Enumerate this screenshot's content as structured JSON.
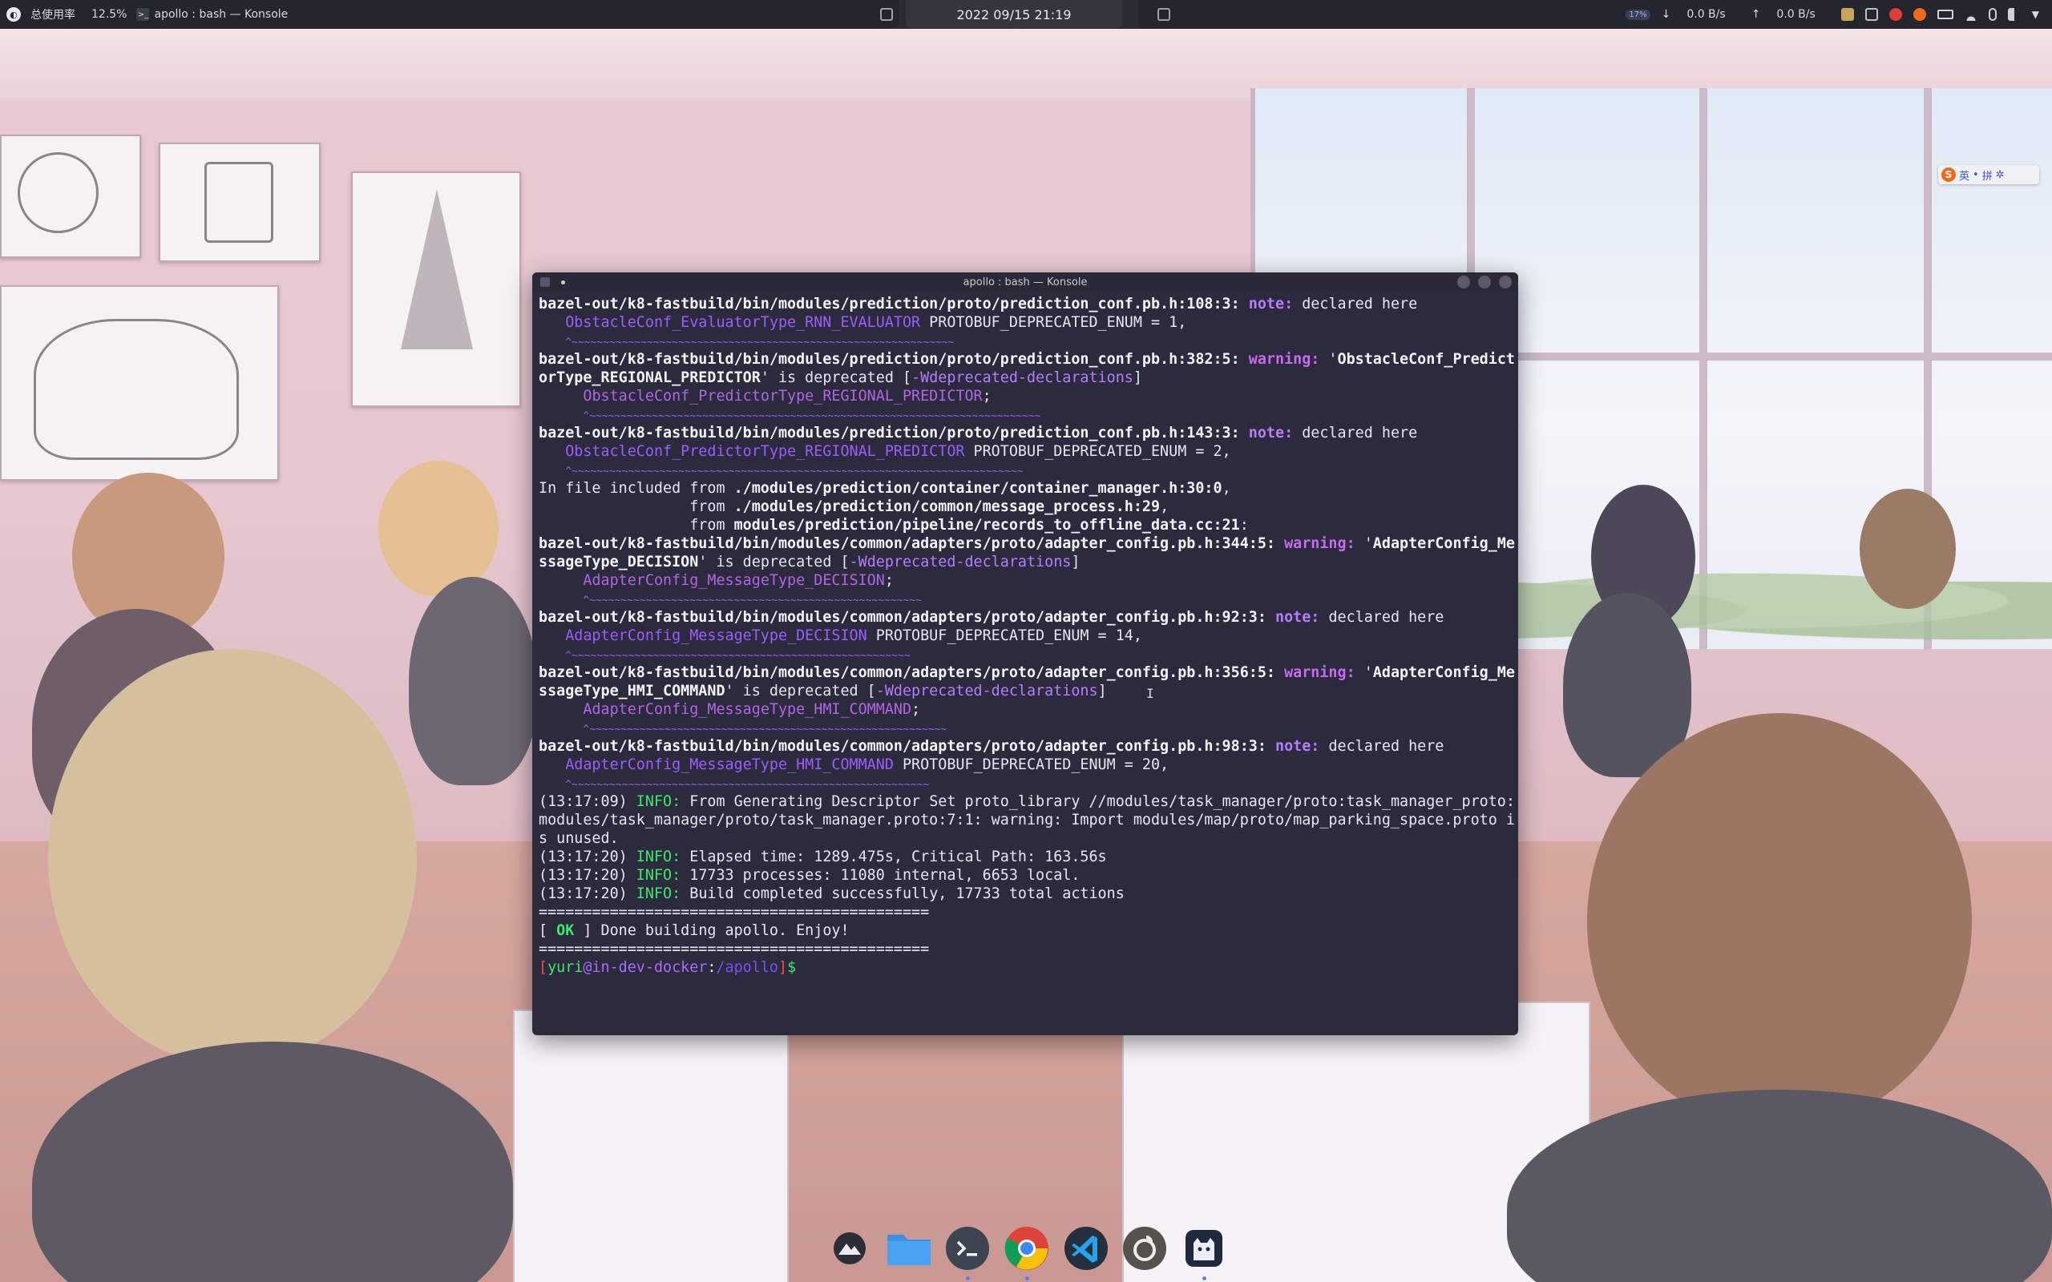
{
  "top_panel": {
    "cpu_label": "总使用率",
    "cpu_value": "12.5%",
    "active_window": "apollo : bash — Konsole",
    "datetime": "2022 09/15 21:19",
    "down_rate": "0.0 B/s",
    "up_rate": "0.0 B/s",
    "down_arrow": "↓",
    "up_arrow": "↑",
    "battery_badge": "17%"
  },
  "ime": {
    "mode": "英",
    "dot": "•",
    "pinyin": "拼",
    "settings": "✲"
  },
  "window": {
    "title": "apollo : bash — Konsole"
  },
  "terminal": {
    "lines": [
      [
        [
          "b",
          "bazel-out/k8-fastbuild/bin/modules/prediction/proto/prediction_conf.pb.h:108:3:"
        ],
        [
          "t",
          " "
        ],
        [
          "note",
          "note:"
        ],
        [
          "t",
          " declared here"
        ]
      ],
      [
        [
          "t",
          "   "
        ],
        [
          "sym",
          "ObstacleConf_EvaluatorType_RNN_EVALUATOR"
        ],
        [
          "t",
          " PROTOBUF_DEPRECATED_ENUM = 1,"
        ]
      ],
      [
        [
          "t",
          "   "
        ],
        [
          "tilde",
          "^~~~~~~~~~~~~~~~~~~~~~~~~~~~~~~~~~~~~~~~~~~~~~~~~~~~~~~~~~~~~~"
        ]
      ],
      [
        [
          "b",
          "bazel-out/k8-fastbuild/bin/modules/prediction/proto/prediction_conf.pb.h:382:5:"
        ],
        [
          "t",
          " "
        ],
        [
          "warn",
          "warning:"
        ],
        [
          "t",
          " '"
        ],
        [
          "b",
          "ObstacleConf_Predict"
        ]
      ],
      [
        [
          "b",
          "orType_REGIONAL_PREDICTOR"
        ],
        [
          "t",
          "' is deprecated ["
        ],
        [
          "flag",
          "-Wdeprecated-declarations"
        ],
        [
          "t",
          "]"
        ]
      ],
      [
        [
          "t",
          "     "
        ],
        [
          "sym2",
          "ObstacleConf_PredictorType_REGIONAL_PREDICTOR"
        ],
        [
          "t",
          ";"
        ]
      ],
      [
        [
          "t",
          "     "
        ],
        [
          "tilde",
          "^~~~~~~~~~~~~~~~~~~~~~~~~~~~~~~~~~~~~~~~~~~~~~~~~~~~~~~~~~~~~~~~~~~~~~~~~"
        ]
      ],
      [
        [
          "b",
          "bazel-out/k8-fastbuild/bin/modules/prediction/proto/prediction_conf.pb.h:143:3:"
        ],
        [
          "t",
          " "
        ],
        [
          "note",
          "note:"
        ],
        [
          "t",
          " declared here"
        ]
      ],
      [
        [
          "t",
          "   "
        ],
        [
          "sym",
          "ObstacleConf_PredictorType_REGIONAL_PREDICTOR"
        ],
        [
          "t",
          " PROTOBUF_DEPRECATED_ENUM = 2,"
        ]
      ],
      [
        [
          "t",
          "   "
        ],
        [
          "tilde",
          "^~~~~~~~~~~~~~~~~~~~~~~~~~~~~~~~~~~~~~~~~~~~~~~~~~~~~~~~~~~~~~~~~~~~~~~~~"
        ]
      ],
      [
        [
          "t",
          "In file included from "
        ],
        [
          "b",
          "./modules/prediction/container/container_manager.h:30:0"
        ],
        [
          "t",
          ","
        ]
      ],
      [
        [
          "t",
          "                 from "
        ],
        [
          "b",
          "./modules/prediction/common/message_process.h:29"
        ],
        [
          "t",
          ","
        ]
      ],
      [
        [
          "t",
          "                 from "
        ],
        [
          "b",
          "modules/prediction/pipeline/records_to_offline_data.cc:21"
        ],
        [
          "t",
          ":"
        ]
      ],
      [
        [
          "b",
          "bazel-out/k8-fastbuild/bin/modules/common/adapters/proto/adapter_config.pb.h:344:5:"
        ],
        [
          "t",
          " "
        ],
        [
          "warn",
          "warning:"
        ],
        [
          "t",
          " '"
        ],
        [
          "b",
          "AdapterConfig_Me"
        ]
      ],
      [
        [
          "b",
          "ssageType_DECISION"
        ],
        [
          "t",
          "' is deprecated ["
        ],
        [
          "flag",
          "-Wdeprecated-declarations"
        ],
        [
          "t",
          "]"
        ]
      ],
      [
        [
          "t",
          "     "
        ],
        [
          "sym2",
          "AdapterConfig_MessageType_DECISION"
        ],
        [
          "t",
          ";"
        ]
      ],
      [
        [
          "t",
          "     "
        ],
        [
          "tilde",
          "^~~~~~~~~~~~~~~~~~~~~~~~~~~~~~~~~~~~~~~~~~~~~~~~~~~~~~"
        ]
      ],
      [
        [
          "b",
          "bazel-out/k8-fastbuild/bin/modules/common/adapters/proto/adapter_config.pb.h:92:3:"
        ],
        [
          "t",
          " "
        ],
        [
          "note",
          "note:"
        ],
        [
          "t",
          " declared here"
        ]
      ],
      [
        [
          "t",
          "   "
        ],
        [
          "sym",
          "AdapterConfig_MessageType_DECISION"
        ],
        [
          "t",
          " PROTOBUF_DEPRECATED_ENUM = 14,"
        ]
      ],
      [
        [
          "t",
          "   "
        ],
        [
          "tilde",
          "^~~~~~~~~~~~~~~~~~~~~~~~~~~~~~~~~~~~~~~~~~~~~~~~~~~~~~~"
        ]
      ],
      [
        [
          "b",
          "bazel-out/k8-fastbuild/bin/modules/common/adapters/proto/adapter_config.pb.h:356:5:"
        ],
        [
          "t",
          " "
        ],
        [
          "warn",
          "warning:"
        ],
        [
          "t",
          " '"
        ],
        [
          "b",
          "AdapterConfig_Me"
        ]
      ],
      [
        [
          "b",
          "ssageType_HMI_COMMAND"
        ],
        [
          "t",
          "' is deprecated ["
        ],
        [
          "flag",
          "-Wdeprecated-declarations"
        ],
        [
          "t",
          "]"
        ]
      ],
      [
        [
          "t",
          "     "
        ],
        [
          "sym2",
          "AdapterConfig_MessageType_HMI_COMMAND"
        ],
        [
          "t",
          ";"
        ]
      ],
      [
        [
          "t",
          "     "
        ],
        [
          "tilde",
          "^~~~~~~~~~~~~~~~~~~~~~~~~~~~~~~~~~~~~~~~~~~~~~~~~~~~~~~~~~"
        ]
      ],
      [
        [
          "b",
          "bazel-out/k8-fastbuild/bin/modules/common/adapters/proto/adapter_config.pb.h:98:3:"
        ],
        [
          "t",
          " "
        ],
        [
          "note",
          "note:"
        ],
        [
          "t",
          " declared here"
        ]
      ],
      [
        [
          "t",
          "   "
        ],
        [
          "sym",
          "AdapterConfig_MessageType_HMI_COMMAND"
        ],
        [
          "t",
          " PROTOBUF_DEPRECATED_ENUM = 20,"
        ]
      ],
      [
        [
          "t",
          "   "
        ],
        [
          "tilde",
          "^~~~~~~~~~~~~~~~~~~~~~~~~~~~~~~~~~~~~~~~~~~~~~~~~~~~~~~~~~"
        ]
      ],
      [
        [
          "t",
          "(13:17:09) "
        ],
        [
          "grn",
          "INFO:"
        ],
        [
          "t",
          " From Generating Descriptor Set proto_library //modules/task_manager/proto:task_manager_proto:"
        ]
      ],
      [
        [
          "t",
          "modules/task_manager/proto/task_manager.proto:7:1: warning: Import modules/map/proto/map_parking_space.proto i"
        ]
      ],
      [
        [
          "t",
          "s unused."
        ]
      ],
      [
        [
          "t",
          "(13:17:20) "
        ],
        [
          "grn",
          "INFO:"
        ],
        [
          "t",
          " Elapsed time: 1289.475s, Critical Path: 163.56s"
        ]
      ],
      [
        [
          "t",
          "(13:17:20) "
        ],
        [
          "grn",
          "INFO:"
        ],
        [
          "t",
          " 17733 processes: 11080 internal, 6653 local."
        ]
      ],
      [
        [
          "t",
          "(13:17:20) "
        ],
        [
          "grn",
          "INFO:"
        ],
        [
          "t",
          " Build completed successfully, 17733 total actions"
        ]
      ],
      [
        [
          "t",
          "============================================"
        ]
      ],
      [
        [
          "t",
          "[ "
        ],
        [
          "ok",
          "OK"
        ],
        [
          "t",
          " ] Done building apollo. Enjoy!"
        ]
      ],
      [
        [
          "t",
          "============================================"
        ]
      ],
      [
        [
          "red",
          "["
        ],
        [
          "grn",
          "yuri"
        ],
        [
          "t",
          ""
        ],
        [
          "host",
          "@in-dev-docker"
        ],
        [
          "t",
          ":"
        ],
        [
          "path",
          "/apollo"
        ],
        [
          "red",
          "]"
        ],
        [
          "grn",
          "$"
        ]
      ]
    ]
  },
  "dock": {
    "items": [
      {
        "name": "launcher",
        "icon": "mountain-icon"
      },
      {
        "name": "files",
        "icon": "folder-icon"
      },
      {
        "name": "konsole",
        "icon": "terminal-icon"
      },
      {
        "name": "chrome",
        "icon": "chrome-icon"
      },
      {
        "name": "vscode",
        "icon": "vscode-icon"
      },
      {
        "name": "netease-music",
        "icon": "music-icon"
      },
      {
        "name": "cat-app",
        "icon": "cat-icon"
      }
    ]
  },
  "colors": {
    "terminal_bg": "#2c2b3d",
    "panel_bg": "#24262d",
    "note": "#b77cff",
    "info": "#3ee86b",
    "prompt_red": "#f34a4a"
  }
}
